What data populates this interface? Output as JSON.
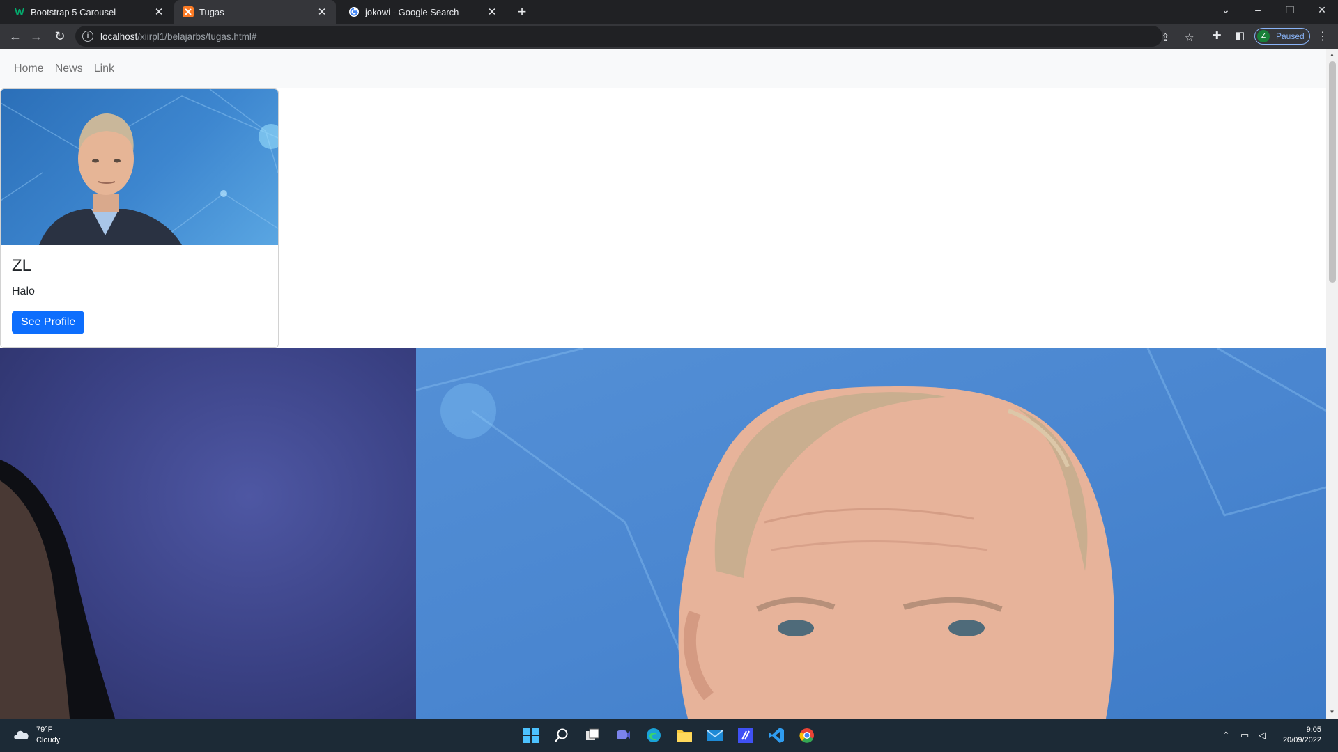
{
  "browser": {
    "tabs": [
      {
        "title": "Bootstrap 5 Carousel",
        "active": false,
        "favicon": "w3schools-icon"
      },
      {
        "title": "Tugas",
        "active": true,
        "favicon": "xampp-icon"
      },
      {
        "title": "jokowi - Google Search",
        "active": false,
        "favicon": "google-icon"
      }
    ],
    "address": {
      "host": "localhost",
      "path": "/xiirpl1/belajarbs/tugas.html#"
    },
    "profile": {
      "initial": "Z",
      "status": "Paused"
    }
  },
  "page": {
    "nav": [
      "Home",
      "News",
      "Link"
    ],
    "card": {
      "title": "ZL",
      "text": "Halo",
      "button": "See Profile"
    }
  },
  "taskbar": {
    "weather": {
      "temp": "79°F",
      "condition": "Cloudy"
    },
    "clock": {
      "time": "9:05",
      "date": "20/09/2022"
    }
  }
}
